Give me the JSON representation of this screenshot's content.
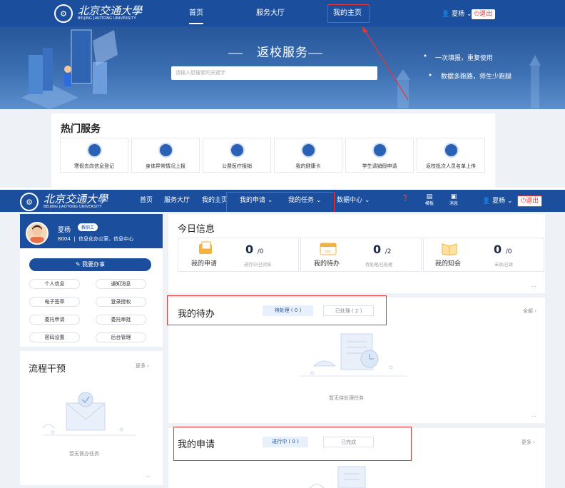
{
  "top": {
    "logo": {
      "cn": "北京交通大學",
      "en": "BEIJING JIAOTONG UNIVERSITY"
    },
    "nav": [
      "首页",
      "服务大厅",
      "我的主页"
    ],
    "user": "夏杨",
    "logout": "退出",
    "banner_title": "返校服务",
    "search_placeholder": "请输入想搜索的关键字",
    "features": [
      "一次填报，重复使用",
      "数据多跑路，师生少跑腿"
    ],
    "hot_title": "热门服务",
    "services": [
      "寒假去向信息登记",
      "身体异常情况上报",
      "公费医疗报销",
      "我的健康卡",
      "学生请销假申请",
      "返校批次人员名单上传"
    ],
    "colors": {
      "nav": "#1b4f9d",
      "accent_red": "#e33"
    }
  },
  "bottom": {
    "nav": [
      "首页",
      "服务大厅",
      "我的主页",
      "我的申请",
      "我的任务",
      "数据中心"
    ],
    "icons": [
      "",
      "模板",
      "消息"
    ],
    "user": "夏杨",
    "logout": "退出",
    "profile": {
      "name": "夏杨",
      "tag": "教职工",
      "id": "8004",
      "dept": "信息化办公室、信息中心"
    },
    "main_button": "我要办事",
    "side_buttons": [
      "个人信息",
      "通知消息",
      "电子签章",
      "登录授权",
      "委托申请",
      "委托审批",
      "密码设置",
      "后台管理"
    ],
    "flow": {
      "title": "流程干预",
      "more": "更多",
      "empty": "暂无督办任务"
    },
    "today": {
      "title": "今日信息",
      "stats": [
        {
          "label": "我的申请",
          "num": "0",
          "total": "/0",
          "sub": "进行中/已完结"
        },
        {
          "label": "我的待办",
          "num": "0",
          "total": "/2",
          "sub": "待处理/已处理"
        },
        {
          "label": "我的知会",
          "num": "0",
          "total": "/0",
          "sub": "未读/已读"
        }
      ]
    },
    "todo": {
      "title": "我的待办",
      "tabs": [
        "待处理 ( 0 )",
        "已处理 ( 2 )"
      ],
      "more": "全部",
      "empty": "暂无待处理任务"
    },
    "apply": {
      "title": "我的申请",
      "tabs": [
        "进行中 ( 0 )",
        "已完成"
      ],
      "more": "更多"
    }
  }
}
